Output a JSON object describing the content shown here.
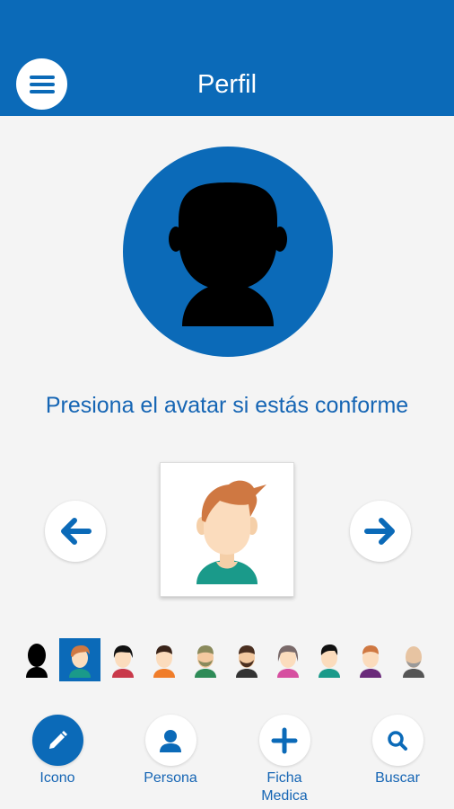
{
  "header": {
    "title": "Perfil"
  },
  "main": {
    "prompt": "Presiona el avatar si estás conforme"
  },
  "avatar_strip": [
    {
      "name": "silhouette"
    },
    {
      "name": "redhead-boy",
      "selected": true
    },
    {
      "name": "black-hair-girl"
    },
    {
      "name": "orange-shirt-boy"
    },
    {
      "name": "bearded-olive"
    },
    {
      "name": "bearded-man"
    },
    {
      "name": "pink-hair-girl"
    },
    {
      "name": "dark-hair-boy"
    },
    {
      "name": "purple-shirt-boy"
    },
    {
      "name": "bald-man"
    }
  ],
  "bottom_nav": [
    {
      "label": "Icono",
      "icon": "pencil-icon",
      "active": true
    },
    {
      "label": "Persona",
      "icon": "person-icon"
    },
    {
      "label": "Ficha\nMedica",
      "icon": "plus-icon"
    },
    {
      "label": "Buscar",
      "icon": "search-icon"
    }
  ],
  "colors": {
    "primary": "#0b6ab8",
    "text_blue": "#1565b4",
    "background": "#f4f4f4"
  }
}
